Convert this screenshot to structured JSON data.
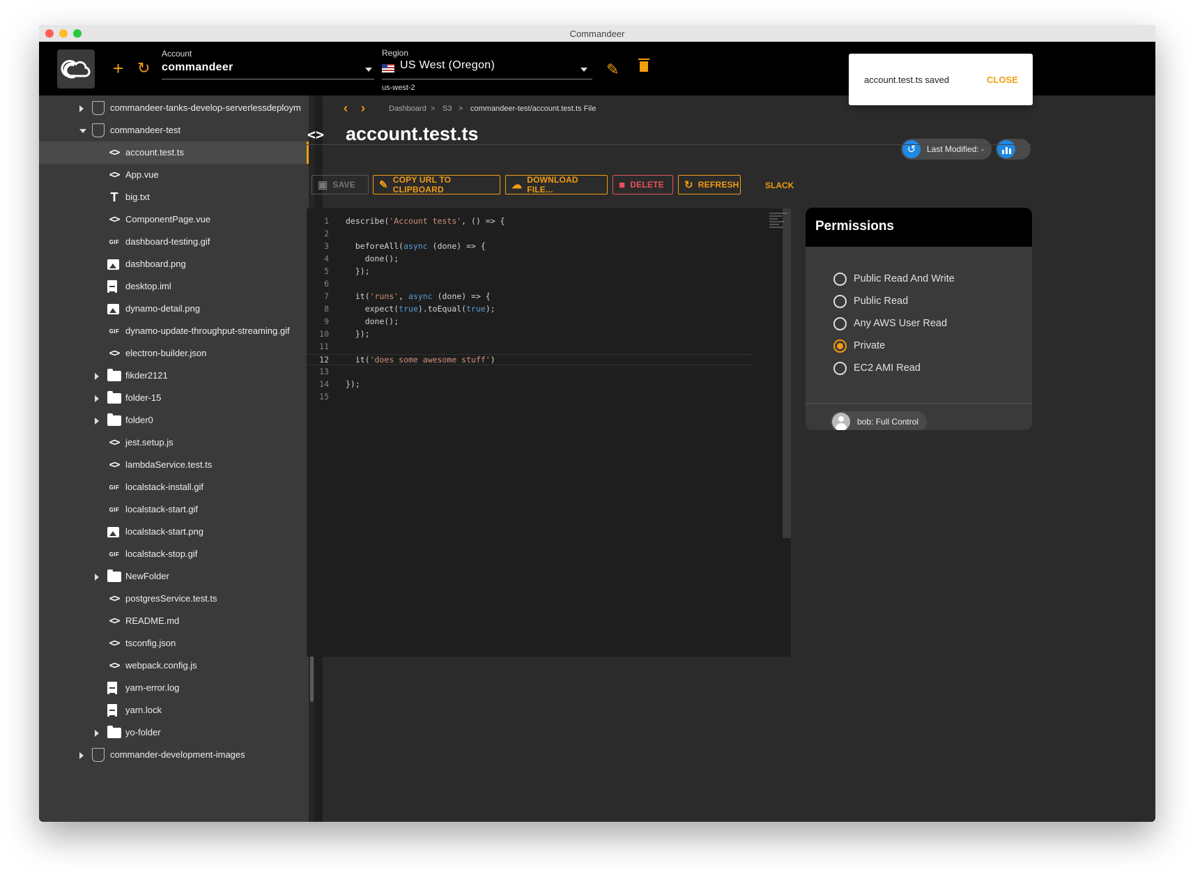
{
  "window": {
    "title": "Commandeer"
  },
  "toolbar": {
    "add_icon": "plus-icon",
    "refresh_icon": "refresh-icon",
    "account_label": "Account",
    "account_value": "commandeer",
    "region_label": "Region",
    "region_value": "US West (Oregon)",
    "region_code": "us-west-2",
    "edit_icon": "pencil-icon",
    "delete_icon": "trash-icon"
  },
  "toast": {
    "message": "account.test.ts saved",
    "close_label": "CLOSE"
  },
  "breadcrumb": {
    "items": [
      "Dashboard",
      "S3",
      "commandeer-test/account.test.ts File"
    ],
    "separator": ">"
  },
  "page": {
    "title": "account.test.ts",
    "last_modified_label": "Last Modified: -"
  },
  "actions": {
    "save": "SAVE",
    "copy_url": "COPY URL TO CLIPBOARD",
    "download": "DOWNLOAD FILE...",
    "delete": "DELETE",
    "refresh": "REFRESH",
    "slack": "SLACK"
  },
  "sidebar": {
    "items": [
      {
        "label": "commandeer-tanks-develop-serverlessdeploym",
        "icon": "bucket-icon",
        "expand": "collapsed",
        "level": 0
      },
      {
        "label": "commandeer-test",
        "icon": "bucket-icon",
        "expand": "expanded",
        "level": 0
      },
      {
        "label": "account.test.ts",
        "icon": "code-icon",
        "expand": "none",
        "level": 1,
        "selected": true
      },
      {
        "label": "App.vue",
        "icon": "code-icon",
        "expand": "none",
        "level": 1
      },
      {
        "label": "big.txt",
        "icon": "text-icon",
        "expand": "none",
        "level": 1
      },
      {
        "label": "ComponentPage.vue",
        "icon": "code-icon",
        "expand": "none",
        "level": 1
      },
      {
        "label": "dashboard-testing.gif",
        "icon": "gif-icon",
        "expand": "none",
        "level": 1
      },
      {
        "label": "dashboard.png",
        "icon": "image-icon",
        "expand": "none",
        "level": 1
      },
      {
        "label": "desktop.iml",
        "icon": "document-icon",
        "expand": "none",
        "level": 1
      },
      {
        "label": "dynamo-detail.png",
        "icon": "image-icon",
        "expand": "none",
        "level": 1
      },
      {
        "label": "dynamo-update-throughput-streaming.gif",
        "icon": "gif-icon",
        "expand": "none",
        "level": 1
      },
      {
        "label": "electron-builder.json",
        "icon": "code-icon",
        "expand": "none",
        "level": 1
      },
      {
        "label": "fikder2121",
        "icon": "folder-icon",
        "expand": "collapsed",
        "level": 1
      },
      {
        "label": "folder-15",
        "icon": "folder-icon",
        "expand": "collapsed",
        "level": 1
      },
      {
        "label": "folder0",
        "icon": "folder-icon",
        "expand": "collapsed",
        "level": 1
      },
      {
        "label": "jest.setup.js",
        "icon": "code-icon",
        "expand": "none",
        "level": 1
      },
      {
        "label": "lambdaService.test.ts",
        "icon": "code-icon",
        "expand": "none",
        "level": 1
      },
      {
        "label": "localstack-install.gif",
        "icon": "gif-icon",
        "expand": "none",
        "level": 1
      },
      {
        "label": "localstack-start.gif",
        "icon": "gif-icon",
        "expand": "none",
        "level": 1
      },
      {
        "label": "localstack-start.png",
        "icon": "image-icon",
        "expand": "none",
        "level": 1
      },
      {
        "label": "localstack-stop.gif",
        "icon": "gif-icon",
        "expand": "none",
        "level": 1
      },
      {
        "label": "NewFolder",
        "icon": "folder-icon",
        "expand": "collapsed",
        "level": 1
      },
      {
        "label": "postgresService.test.ts",
        "icon": "code-icon",
        "expand": "none",
        "level": 1
      },
      {
        "label": "README.md",
        "icon": "code-icon",
        "expand": "none",
        "level": 1
      },
      {
        "label": "tsconfig.json",
        "icon": "code-icon",
        "expand": "none",
        "level": 1
      },
      {
        "label": "webpack.config.js",
        "icon": "code-icon",
        "expand": "none",
        "level": 1
      },
      {
        "label": "yarn-error.log",
        "icon": "document-icon",
        "expand": "none",
        "level": 1
      },
      {
        "label": "yarn.lock",
        "icon": "document-icon",
        "expand": "none",
        "level": 1
      },
      {
        "label": "yo-folder",
        "icon": "folder-icon",
        "expand": "collapsed",
        "level": 1
      },
      {
        "label": "commander-development-images",
        "icon": "bucket-icon",
        "expand": "collapsed",
        "level": 0
      }
    ]
  },
  "editor": {
    "current_line": 12,
    "lines": [
      [
        [
          "describe(",
          "p"
        ],
        [
          "'Account tests'",
          "s"
        ],
        [
          ", () => {",
          "p"
        ]
      ],
      [],
      [
        [
          "  beforeAll(",
          "p"
        ],
        [
          "async",
          "k"
        ],
        [
          " (done) => {",
          "p"
        ]
      ],
      [
        [
          "    done();",
          "p"
        ]
      ],
      [
        [
          "  });",
          "p"
        ]
      ],
      [],
      [
        [
          "  it(",
          "p"
        ],
        [
          "'runs'",
          "s"
        ],
        [
          ", ",
          "p"
        ],
        [
          "async",
          "k"
        ],
        [
          " (done) => {",
          "p"
        ]
      ],
      [
        [
          "    expect(",
          "p"
        ],
        [
          "true",
          "k"
        ],
        [
          ").toEqual(",
          "p"
        ],
        [
          "true",
          "k"
        ],
        [
          ");",
          "p"
        ]
      ],
      [
        [
          "    done();",
          "p"
        ]
      ],
      [
        [
          "  });",
          "p"
        ]
      ],
      [],
      [
        [
          "  it(",
          "p"
        ],
        [
          "'does some awesome stuff'",
          "s"
        ],
        [
          ")",
          "p"
        ]
      ],
      [],
      [
        [
          "});",
          "p"
        ]
      ],
      []
    ],
    "colors": {
      "p": "#d4d4d4",
      "s": "#ce9178",
      "k": "#569cd6"
    }
  },
  "permissions": {
    "title": "Permissions",
    "options": [
      {
        "label": "Public Read And Write",
        "selected": false
      },
      {
        "label": "Public Read",
        "selected": false
      },
      {
        "label": "Any AWS User Read",
        "selected": false
      },
      {
        "label": "Private",
        "selected": true
      },
      {
        "label": "EC2 AMI Read",
        "selected": false
      }
    ],
    "grantee": "bob: Full Control"
  },
  "colors": {
    "accent": "#f39c12",
    "danger": "#e8505b",
    "info": "#1e88e5"
  }
}
